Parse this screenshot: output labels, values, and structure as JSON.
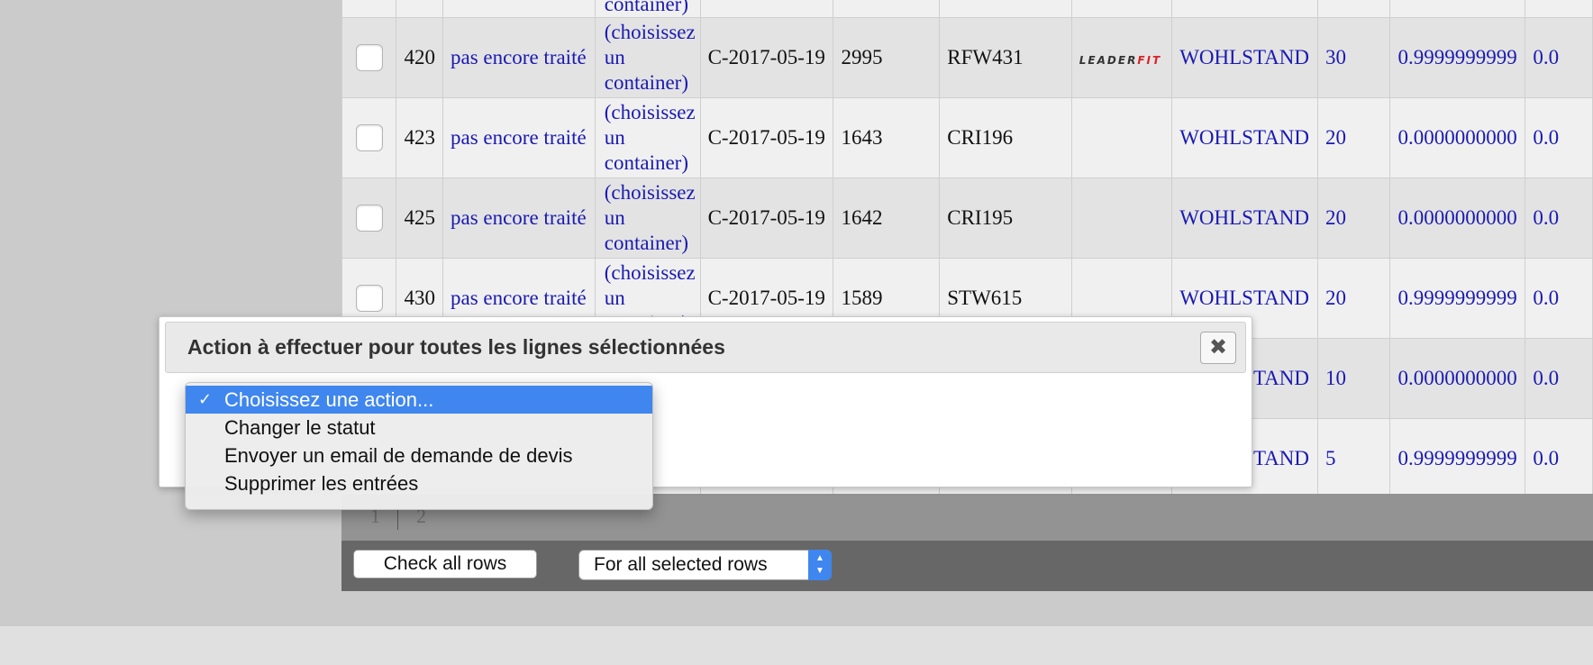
{
  "table": {
    "top_cells": [
      "",
      "",
      "",
      "container)",
      "",
      "",
      "",
      "",
      "",
      "",
      "",
      ""
    ],
    "rows": [
      {
        "id": "420",
        "status": "pas encore traité",
        "container": "(choisissez un container)",
        "date": "C-2017-05-19",
        "num": "2995",
        "code": "RFW431",
        "logo": true,
        "supplier": "WOHLSTAND",
        "qty": "30",
        "price": "0.9999999999",
        "price2": "0.0"
      },
      {
        "id": "423",
        "status": "pas encore traité",
        "container": "(choisissez un container)",
        "date": "C-2017-05-19",
        "num": "1643",
        "code": "CRI196",
        "logo": false,
        "supplier": "WOHLSTAND",
        "qty": "20",
        "price": "0.0000000000",
        "price2": "0.0"
      },
      {
        "id": "425",
        "status": "pas encore traité",
        "container": "(choisissez un container)",
        "date": "C-2017-05-19",
        "num": "1642",
        "code": "CRI195",
        "logo": false,
        "supplier": "WOHLSTAND",
        "qty": "20",
        "price": "0.0000000000",
        "price2": "0.0"
      },
      {
        "id": "430",
        "status": "pas encore traité",
        "container": "(choisissez un container)",
        "date": "C-2017-05-19",
        "num": "1589",
        "code": "STW615",
        "logo": false,
        "supplier": "WOHLSTAND",
        "qty": "20",
        "price": "0.9999999999",
        "price2": "0.0"
      },
      {
        "id": "",
        "status": "",
        "container": "",
        "date": "",
        "num": "",
        "code": "",
        "logo": false,
        "supplier": "WOHLSTAND",
        "qty": "10",
        "price": "0.0000000000",
        "price2": "0.0"
      },
      {
        "id": "",
        "status": "",
        "container": "",
        "date": "",
        "num": "",
        "code": "",
        "logo": false,
        "supplier": "WOHLSTAND",
        "qty": "5",
        "price": "0.9999999999",
        "price2": "0.0"
      }
    ],
    "logo_parts": [
      "LEADER",
      "FIT"
    ]
  },
  "pager": {
    "pages": [
      "1",
      "2"
    ]
  },
  "footer": {
    "check_all_label": "Check all rows",
    "bulk_select_value": "For all selected rows"
  },
  "dialog": {
    "title": "Action à effectuer pour toutes les lignes sélectionnées",
    "close_icon": "close-icon"
  },
  "dropdown": {
    "options": [
      "Choisissez une action...",
      "Changer le statut",
      "Envoyer un email de demande de devis",
      "Supprimer les entrées"
    ],
    "selected_index": 0,
    "check_glyph": "✓"
  },
  "colors": {
    "link": "#1a1ab2",
    "accent": "#3f86ee",
    "logo_red": "#d8232a"
  }
}
